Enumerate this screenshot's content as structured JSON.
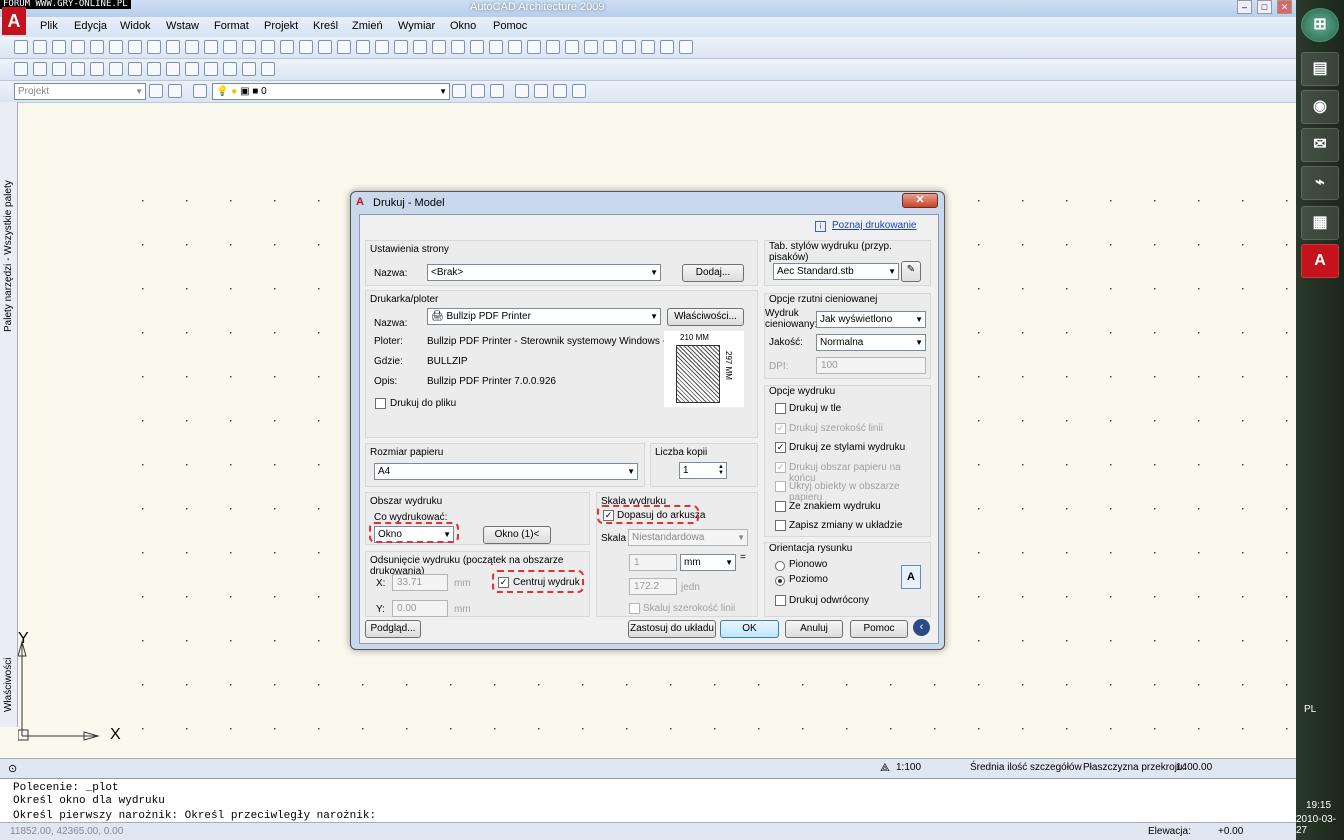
{
  "watermark": "FORUM WWW.GRY-ONLINE.PL",
  "app_title": "AutoCAD Architecture 2009",
  "menu": [
    "Plik",
    "Edycja",
    "Widok",
    "Wstaw",
    "Format",
    "Projekt",
    "Kreśl",
    "Zmień",
    "Wymiar",
    "Okno",
    "Pomoc"
  ],
  "layer_toolbar": {
    "project": "Projekt",
    "layer": "0"
  },
  "side_palettes": {
    "tools": "Palety narzędzi - Wszystkie palety",
    "props": "Właściwości"
  },
  "ucs": {
    "y": "Y",
    "x": "X"
  },
  "dialog": {
    "title": "Drukuj - Model",
    "help_link": "Poznaj drukowanie",
    "page_setup": {
      "group": "Ustawienia strony",
      "name_label": "Nazwa:",
      "name_value": "<Brak>",
      "add_button": "Dodaj..."
    },
    "printer": {
      "group": "Drukarka/ploter",
      "name_label": "Nazwa:",
      "name_value": "Bullzip PDF Printer",
      "props_button": "Właściwości...",
      "plotter_label": "Ploter:",
      "plotter_value": "Bullzip PDF Printer - Sterownik systemowy Windows - op...",
      "where_label": "Gdzie:",
      "where_value": "BULLZIP",
      "desc_label": "Opis:",
      "desc_value": "Bullzip PDF Printer 7.0.0.926",
      "print_to_file": "Drukuj do pliku",
      "paper_w": "210 MM",
      "paper_h": "297 MM"
    },
    "paper_size": {
      "group": "Rozmiar papieru",
      "value": "A4"
    },
    "copies": {
      "group": "Liczba kopii",
      "value": "1"
    },
    "plot_area": {
      "group": "Obszar wydruku",
      "what_label": "Co wydrukować:",
      "what_value": "Okno",
      "window_button": "Okno (1)<"
    },
    "plot_offset": {
      "group": "Odsunięcie wydruku (początek na obszarze drukowania)",
      "x_label": "X:",
      "x_value": "33.71",
      "y_label": "Y:",
      "y_value": "0.00",
      "unit": "mm",
      "center": "Centruj wydruk"
    },
    "plot_scale": {
      "group": "Skala wydruku",
      "fit": "Dopasuj do arkusza",
      "scale_label": "Skala :",
      "scale_value": "Niestandardowa",
      "v1": "1",
      "unit": "mm",
      "eq": "=",
      "v2": "172.2",
      "unit2": "jedn",
      "lineweights": "Skaluj szerokość linii"
    },
    "style_table": {
      "group": "Tab. stylów wydruku (przyp. pisaków)",
      "value": "Aec Standard.stb"
    },
    "shaded": {
      "group": "Opcje rzutni cieniowanej",
      "output_label": "Wydruk cieniowany:",
      "output_value": "Jak wyświetlono",
      "quality_label": "Jakość:",
      "quality_value": "Normalna",
      "dpi_label": "DPI:",
      "dpi_value": "100"
    },
    "options": {
      "group": "Opcje wydruku",
      "items": [
        {
          "label": "Drukuj w tle",
          "checked": false,
          "disabled": false
        },
        {
          "label": "Drukuj szerokość linii",
          "checked": true,
          "disabled": true
        },
        {
          "label": "Drukuj ze stylami wydruku",
          "checked": true,
          "disabled": false
        },
        {
          "label": "Drukuj obszar papieru na końcu",
          "checked": true,
          "disabled": true
        },
        {
          "label": "Ukryj obiekty w obszarze papieru",
          "checked": false,
          "disabled": true
        },
        {
          "label": "Ze znakiem wydruku",
          "checked": false,
          "disabled": false
        },
        {
          "label": "Zapisz zmiany w układzie",
          "checked": false,
          "disabled": false
        }
      ]
    },
    "orientation": {
      "group": "Orientacja rysunku",
      "portrait": "Pionowo",
      "landscape": "Poziomo",
      "upside": "Drukuj odwrócony"
    },
    "buttons": {
      "preview": "Podgląd...",
      "apply": "Zastosuj do układu",
      "ok": "OK",
      "cancel": "Anuluj",
      "help": "Pomoc"
    }
  },
  "status": {
    "scale": "1:100",
    "detail": "Średnia ilość szczegółów",
    "cut_label": "Płaszczyzna przekroju:",
    "cut_value": "1400.00"
  },
  "command": {
    "lines": [
      "Polecenie: _plot",
      "Określ okno dla wydruku",
      "Określ pierwszy narożnik: Określ przeciwległy narożnik:"
    ]
  },
  "bottom": {
    "coords": "11852.00, 42365.00, 0.00",
    "elev": "Elewacja:",
    "elev_value": "+0.00"
  },
  "tray": {
    "lang": "PL",
    "time": "19:15",
    "date": "2010-03-27"
  }
}
